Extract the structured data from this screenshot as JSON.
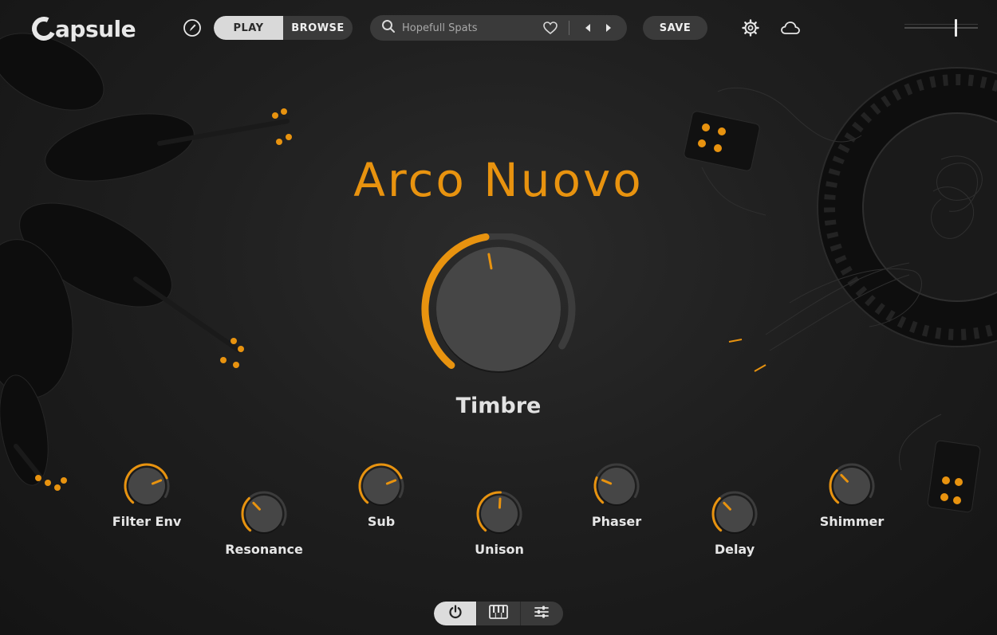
{
  "app": {
    "logo_text": "apsule"
  },
  "header": {
    "edit_icon": "pencil-icon",
    "tabs": [
      {
        "label": "PLAY",
        "active": true
      },
      {
        "label": "BROWSE",
        "active": false
      }
    ],
    "search": {
      "value": "Hopefull Spats",
      "icon": "search-icon"
    },
    "favorite_icon": "heart-icon",
    "prev_icon": "triangle-left-icon",
    "next_icon": "triangle-right-icon",
    "save_label": "SAVE",
    "settings_icon": "gear-icon",
    "cloud_icon": "cloud-icon",
    "volume_level": 0.7
  },
  "preset": {
    "name": "Arco Nuovo"
  },
  "main_knob": {
    "label": "Timbre",
    "value": 0.5
  },
  "knobs": [
    {
      "label": "Filter Env",
      "value": 0.8
    },
    {
      "label": "Resonance",
      "value": 0.37
    },
    {
      "label": "Sub",
      "value": 0.8
    },
    {
      "label": "Unison",
      "value": 0.55
    },
    {
      "label": "Phaser",
      "value": 0.28
    },
    {
      "label": "Delay",
      "value": 0.37
    },
    {
      "label": "Shimmer",
      "value": 0.37
    }
  ],
  "footer": {
    "buttons": [
      {
        "icon": "power-icon",
        "active": true
      },
      {
        "icon": "keyboard-icon",
        "active": false
      },
      {
        "icon": "sliders-icon",
        "active": false
      }
    ]
  },
  "colors": {
    "accent": "#e8930f",
    "background": "#1f1f1f",
    "control_bg": "#3a3a3a",
    "knob_track": "#3c3c3c",
    "knob_body": "#464646",
    "text": "#e6e6e6"
  }
}
